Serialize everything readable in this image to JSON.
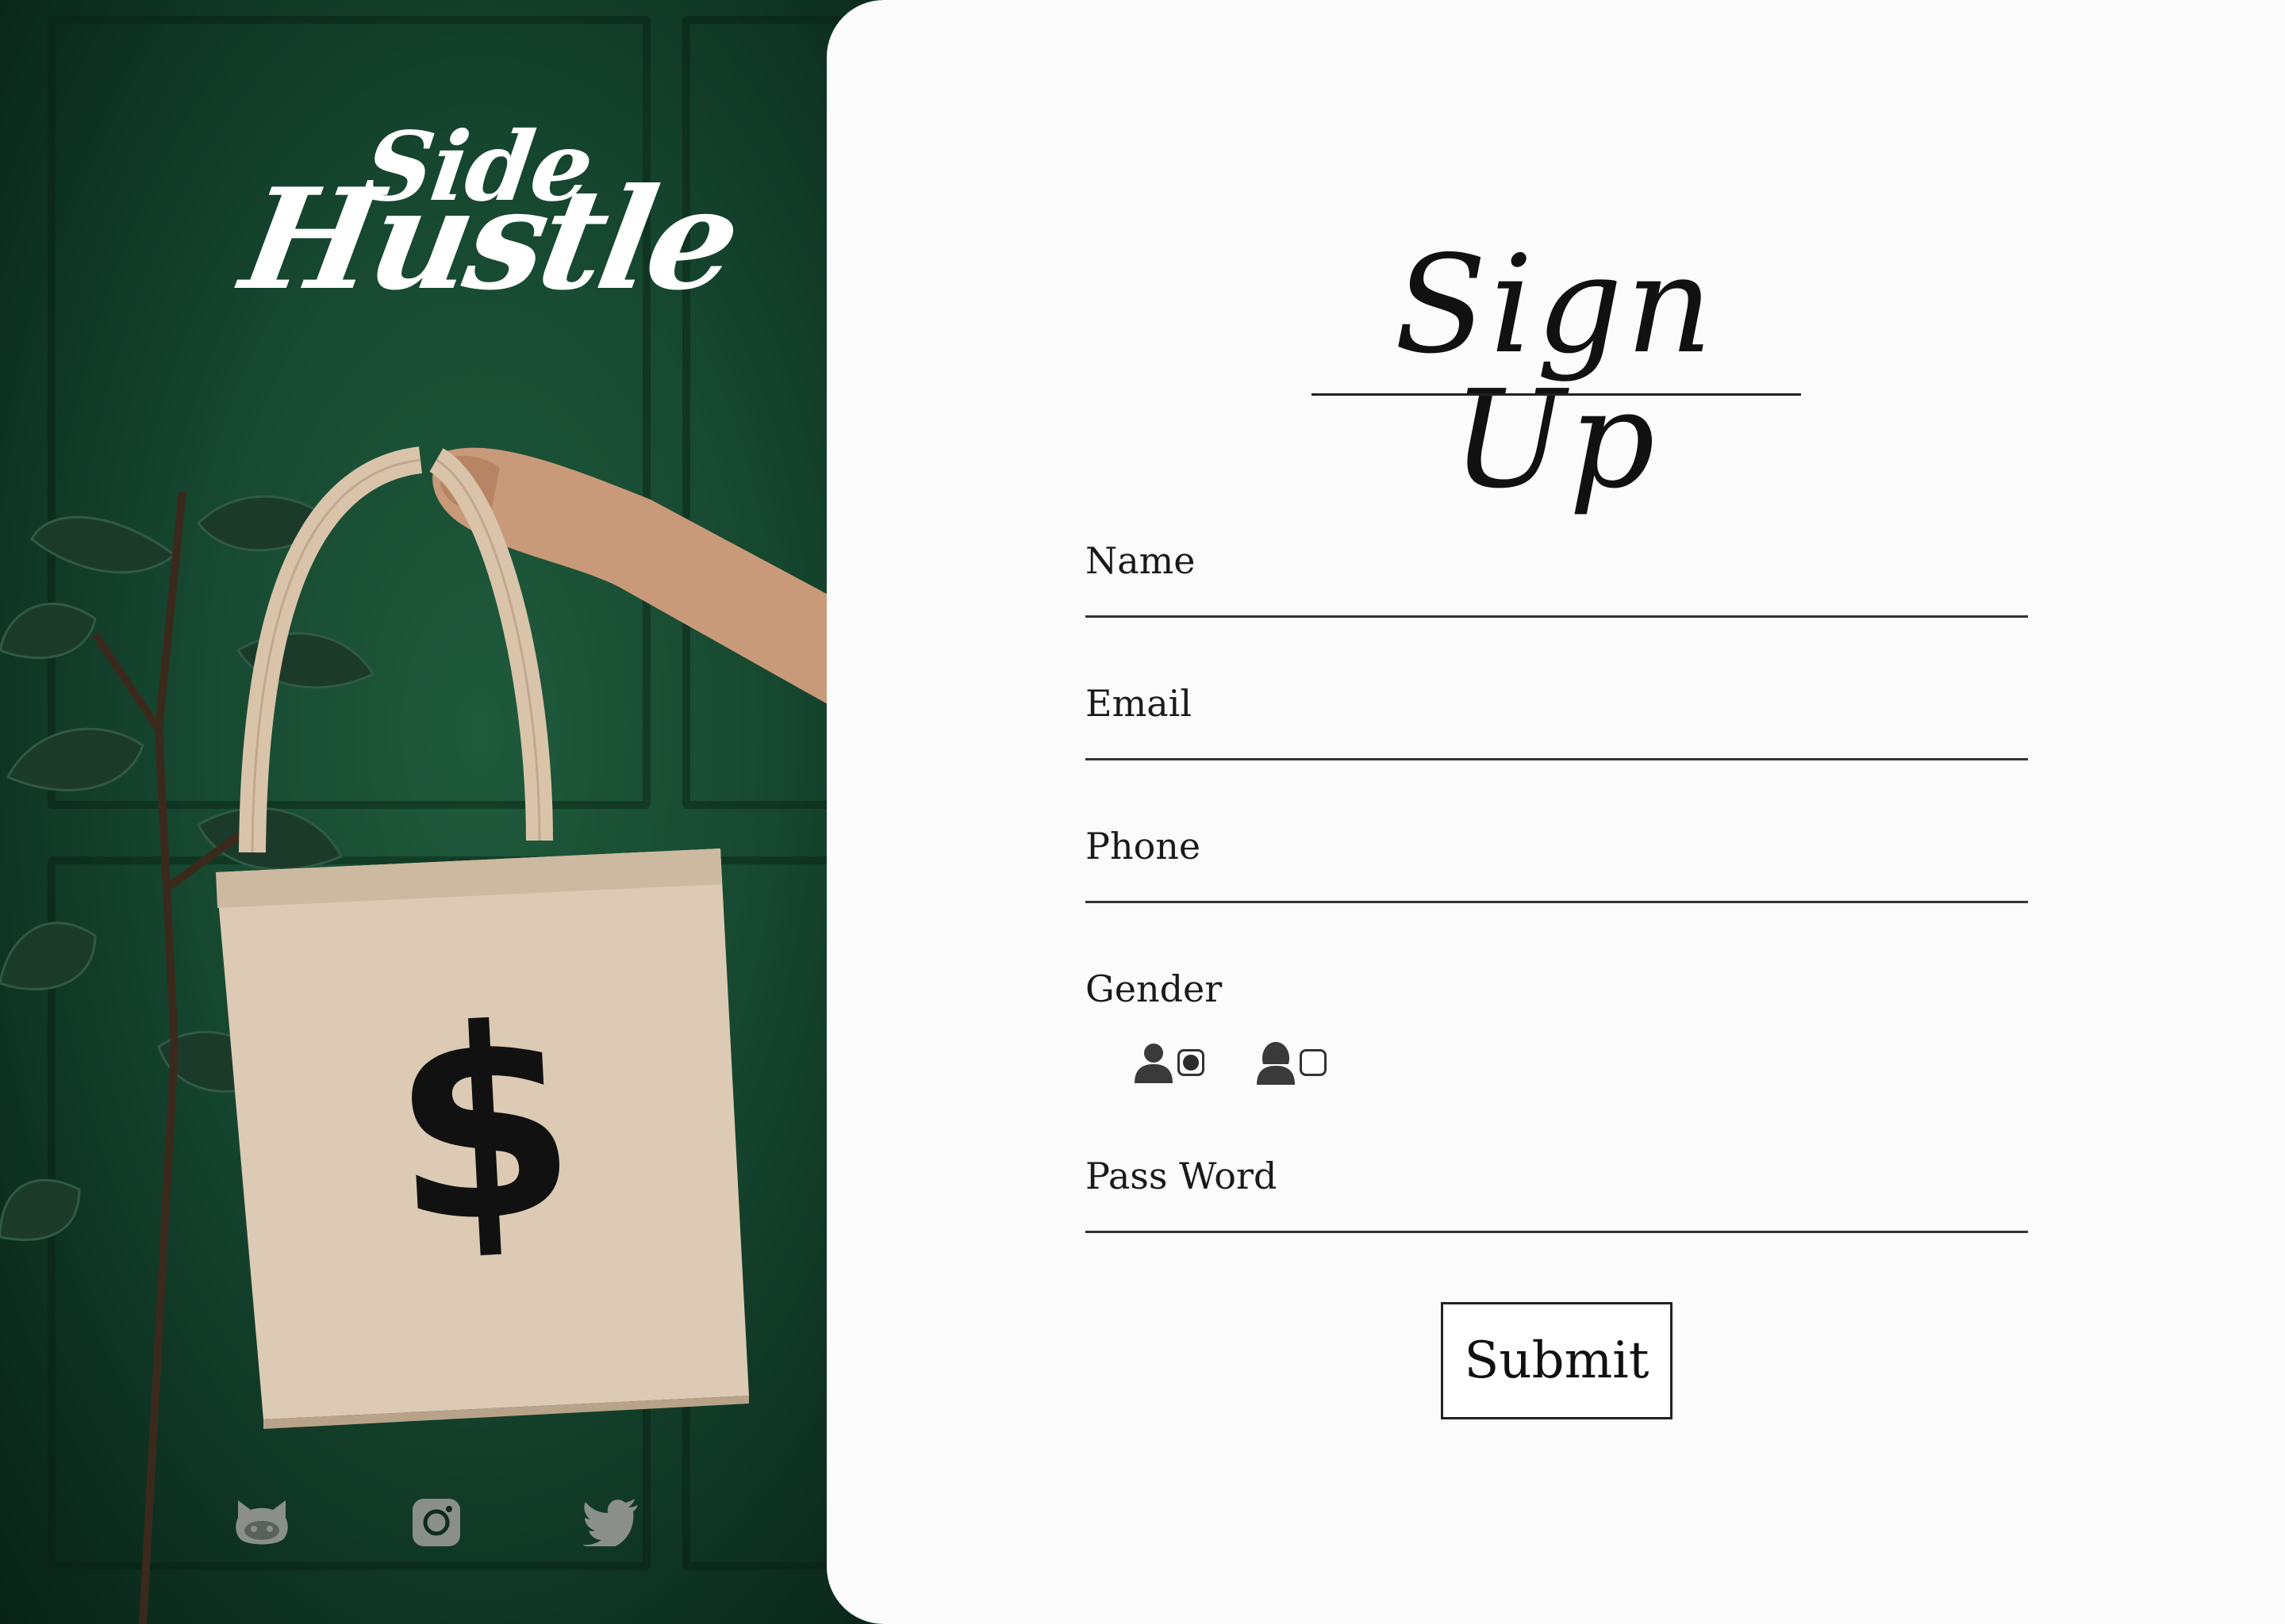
{
  "brand": {
    "logo_line1": "Side",
    "logo_line2": "Hustle"
  },
  "hero": {
    "bag_symbol": "$"
  },
  "social": [
    {
      "icon": "github-icon"
    },
    {
      "icon": "instagram-icon"
    },
    {
      "icon": "twitter-icon"
    }
  ],
  "form": {
    "title": "Sign Up",
    "fields": {
      "name": {
        "label": "Name",
        "value": ""
      },
      "email": {
        "label": "Email",
        "value": ""
      },
      "phone": {
        "label": "Phone",
        "value": ""
      },
      "password": {
        "label": "Pass Word",
        "value": ""
      }
    },
    "gender": {
      "label": "Gender",
      "options": [
        {
          "icon": "male-user-icon",
          "selected": true
        },
        {
          "icon": "female-user-icon",
          "selected": false
        }
      ]
    },
    "submit_label": "Submit"
  },
  "colors": {
    "panel_background": "#fbfbfb",
    "photo_wall": "#174a31",
    "text": "#111111",
    "social_icon": "#8a8f8c",
    "bag": "#dccab4"
  }
}
